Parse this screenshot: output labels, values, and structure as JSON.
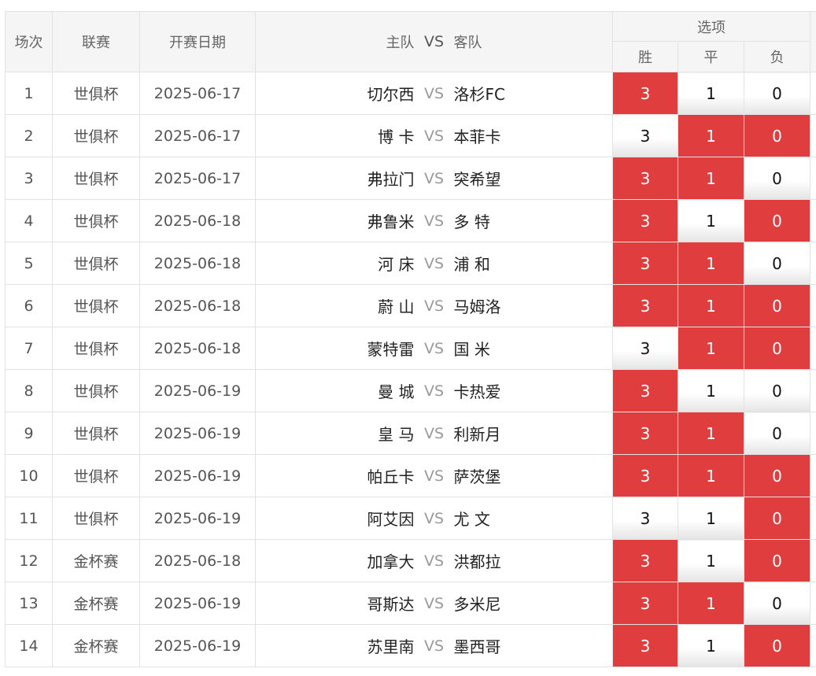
{
  "header": {
    "col_index": "场次",
    "col_league": "联赛",
    "col_date": "开赛日期",
    "col_home": "主队",
    "col_vs": "VS",
    "col_away": "客队",
    "col_options": "选项",
    "opt_win": "胜",
    "opt_draw": "平",
    "opt_lose": "负"
  },
  "colors": {
    "selected": "#e03d3f",
    "header_bg": "#f5f5f5"
  },
  "rows": [
    {
      "idx": "1",
      "league": "世俱杯",
      "date": "2025-06-17",
      "home": "切尔西",
      "vs": "VS",
      "away": "洛杉FC",
      "win": "3",
      "draw": "1",
      "lose": "0",
      "sel": [
        true,
        false,
        false
      ]
    },
    {
      "idx": "2",
      "league": "世俱杯",
      "date": "2025-06-17",
      "home": "博 卡",
      "vs": "VS",
      "away": "本菲卡",
      "win": "3",
      "draw": "1",
      "lose": "0",
      "sel": [
        false,
        true,
        true
      ]
    },
    {
      "idx": "3",
      "league": "世俱杯",
      "date": "2025-06-17",
      "home": "弗拉门",
      "vs": "VS",
      "away": "突希望",
      "win": "3",
      "draw": "1",
      "lose": "0",
      "sel": [
        true,
        true,
        false
      ]
    },
    {
      "idx": "4",
      "league": "世俱杯",
      "date": "2025-06-18",
      "home": "弗鲁米",
      "vs": "VS",
      "away": "多 特",
      "win": "3",
      "draw": "1",
      "lose": "0",
      "sel": [
        true,
        false,
        true
      ]
    },
    {
      "idx": "5",
      "league": "世俱杯",
      "date": "2025-06-18",
      "home": "河 床",
      "vs": "VS",
      "away": "浦 和",
      "win": "3",
      "draw": "1",
      "lose": "0",
      "sel": [
        true,
        true,
        false
      ]
    },
    {
      "idx": "6",
      "league": "世俱杯",
      "date": "2025-06-18",
      "home": "蔚 山",
      "vs": "VS",
      "away": "马姆洛",
      "win": "3",
      "draw": "1",
      "lose": "0",
      "sel": [
        true,
        true,
        true
      ]
    },
    {
      "idx": "7",
      "league": "世俱杯",
      "date": "2025-06-18",
      "home": "蒙特雷",
      "vs": "VS",
      "away": "国 米",
      "win": "3",
      "draw": "1",
      "lose": "0",
      "sel": [
        false,
        true,
        true
      ]
    },
    {
      "idx": "8",
      "league": "世俱杯",
      "date": "2025-06-19",
      "home": "曼 城",
      "vs": "VS",
      "away": "卡热爱",
      "win": "3",
      "draw": "1",
      "lose": "0",
      "sel": [
        true,
        false,
        false
      ]
    },
    {
      "idx": "9",
      "league": "世俱杯",
      "date": "2025-06-19",
      "home": "皇 马",
      "vs": "VS",
      "away": "利新月",
      "win": "3",
      "draw": "1",
      "lose": "0",
      "sel": [
        true,
        true,
        false
      ]
    },
    {
      "idx": "10",
      "league": "世俱杯",
      "date": "2025-06-19",
      "home": "帕丘卡",
      "vs": "VS",
      "away": "萨茨堡",
      "win": "3",
      "draw": "1",
      "lose": "0",
      "sel": [
        true,
        true,
        true
      ]
    },
    {
      "idx": "11",
      "league": "世俱杯",
      "date": "2025-06-19",
      "home": "阿艾因",
      "vs": "VS",
      "away": "尤 文",
      "win": "3",
      "draw": "1",
      "lose": "0",
      "sel": [
        false,
        false,
        true
      ]
    },
    {
      "idx": "12",
      "league": "金杯赛",
      "date": "2025-06-18",
      "home": "加拿大",
      "vs": "VS",
      "away": "洪都拉",
      "win": "3",
      "draw": "1",
      "lose": "0",
      "sel": [
        true,
        false,
        true
      ]
    },
    {
      "idx": "13",
      "league": "金杯赛",
      "date": "2025-06-19",
      "home": "哥斯达",
      "vs": "VS",
      "away": "多米尼",
      "win": "3",
      "draw": "1",
      "lose": "0",
      "sel": [
        true,
        true,
        false
      ]
    },
    {
      "idx": "14",
      "league": "金杯赛",
      "date": "2025-06-19",
      "home": "苏里南",
      "vs": "VS",
      "away": "墨西哥",
      "win": "3",
      "draw": "1",
      "lose": "0",
      "sel": [
        true,
        false,
        true
      ]
    }
  ]
}
